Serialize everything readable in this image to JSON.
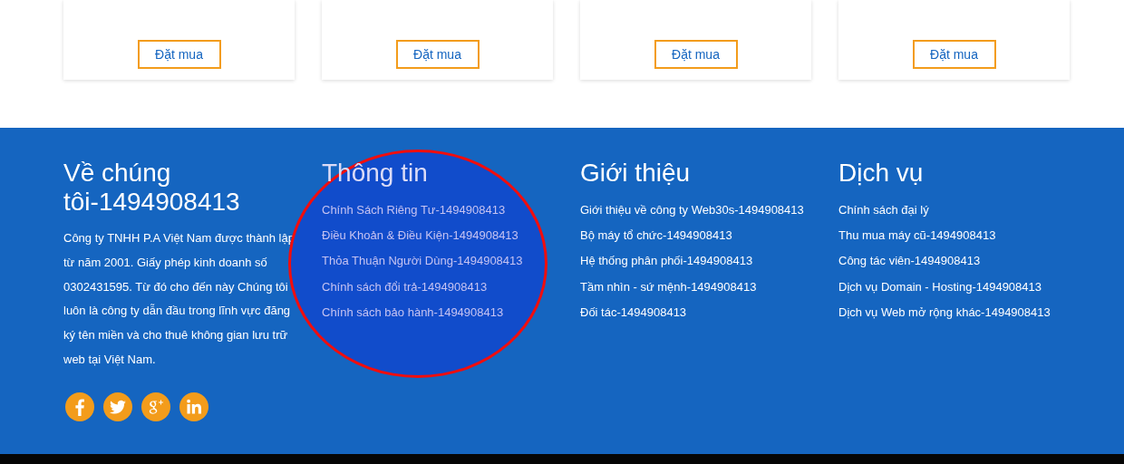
{
  "products": [
    {
      "button": "Đặt mua"
    },
    {
      "button": "Đặt mua"
    },
    {
      "button": "Đặt mua"
    },
    {
      "button": "Đặt mua"
    }
  ],
  "footer": {
    "about": {
      "title": "Về chúng tôi-1494908413",
      "text": "Công ty TNHH P.A Việt Nam được thành lập từ năm 2001. Giấy phép kinh doanh số 0302431595. Từ đó cho đến này Chúng tôi luôn là công ty dẫn đầu trong lĩnh vực đăng ký tên miền và cho thuê không gian lưu trữ web tại Việt Nam.",
      "social": [
        {
          "kind": "facebook"
        },
        {
          "kind": "twitter"
        },
        {
          "kind": "googleplus"
        },
        {
          "kind": "linkedin"
        }
      ]
    },
    "columns": [
      {
        "title": "Thông tin",
        "highlighted": true,
        "links": [
          "Chính Sách Riêng Tư-1494908413",
          "Điều Khoản & Điều Kiện-1494908413",
          "Thỏa Thuận Người Dùng-1494908413",
          "Chính sách đổi trả-1494908413",
          "Chính sách bảo hành-1494908413"
        ]
      },
      {
        "title": "Giới thiệu",
        "highlighted": false,
        "links": [
          "Giới thiệu về công ty Web30s-1494908413",
          "Bộ máy tổ chức-1494908413",
          "Hệ thống phân phối-1494908413",
          "Tầm nhìn - sứ mệnh-1494908413",
          "Đối tác-1494908413"
        ]
      },
      {
        "title": "Dịch vụ",
        "highlighted": false,
        "links": [
          "Chính sách đại lý",
          "Thu mua máy cũ-1494908413",
          "Công tác viên-1494908413",
          "Dịch vụ Domain - Hosting-1494908413",
          "Dịch vụ Web mở rộng khác-1494908413"
        ]
      }
    ]
  }
}
